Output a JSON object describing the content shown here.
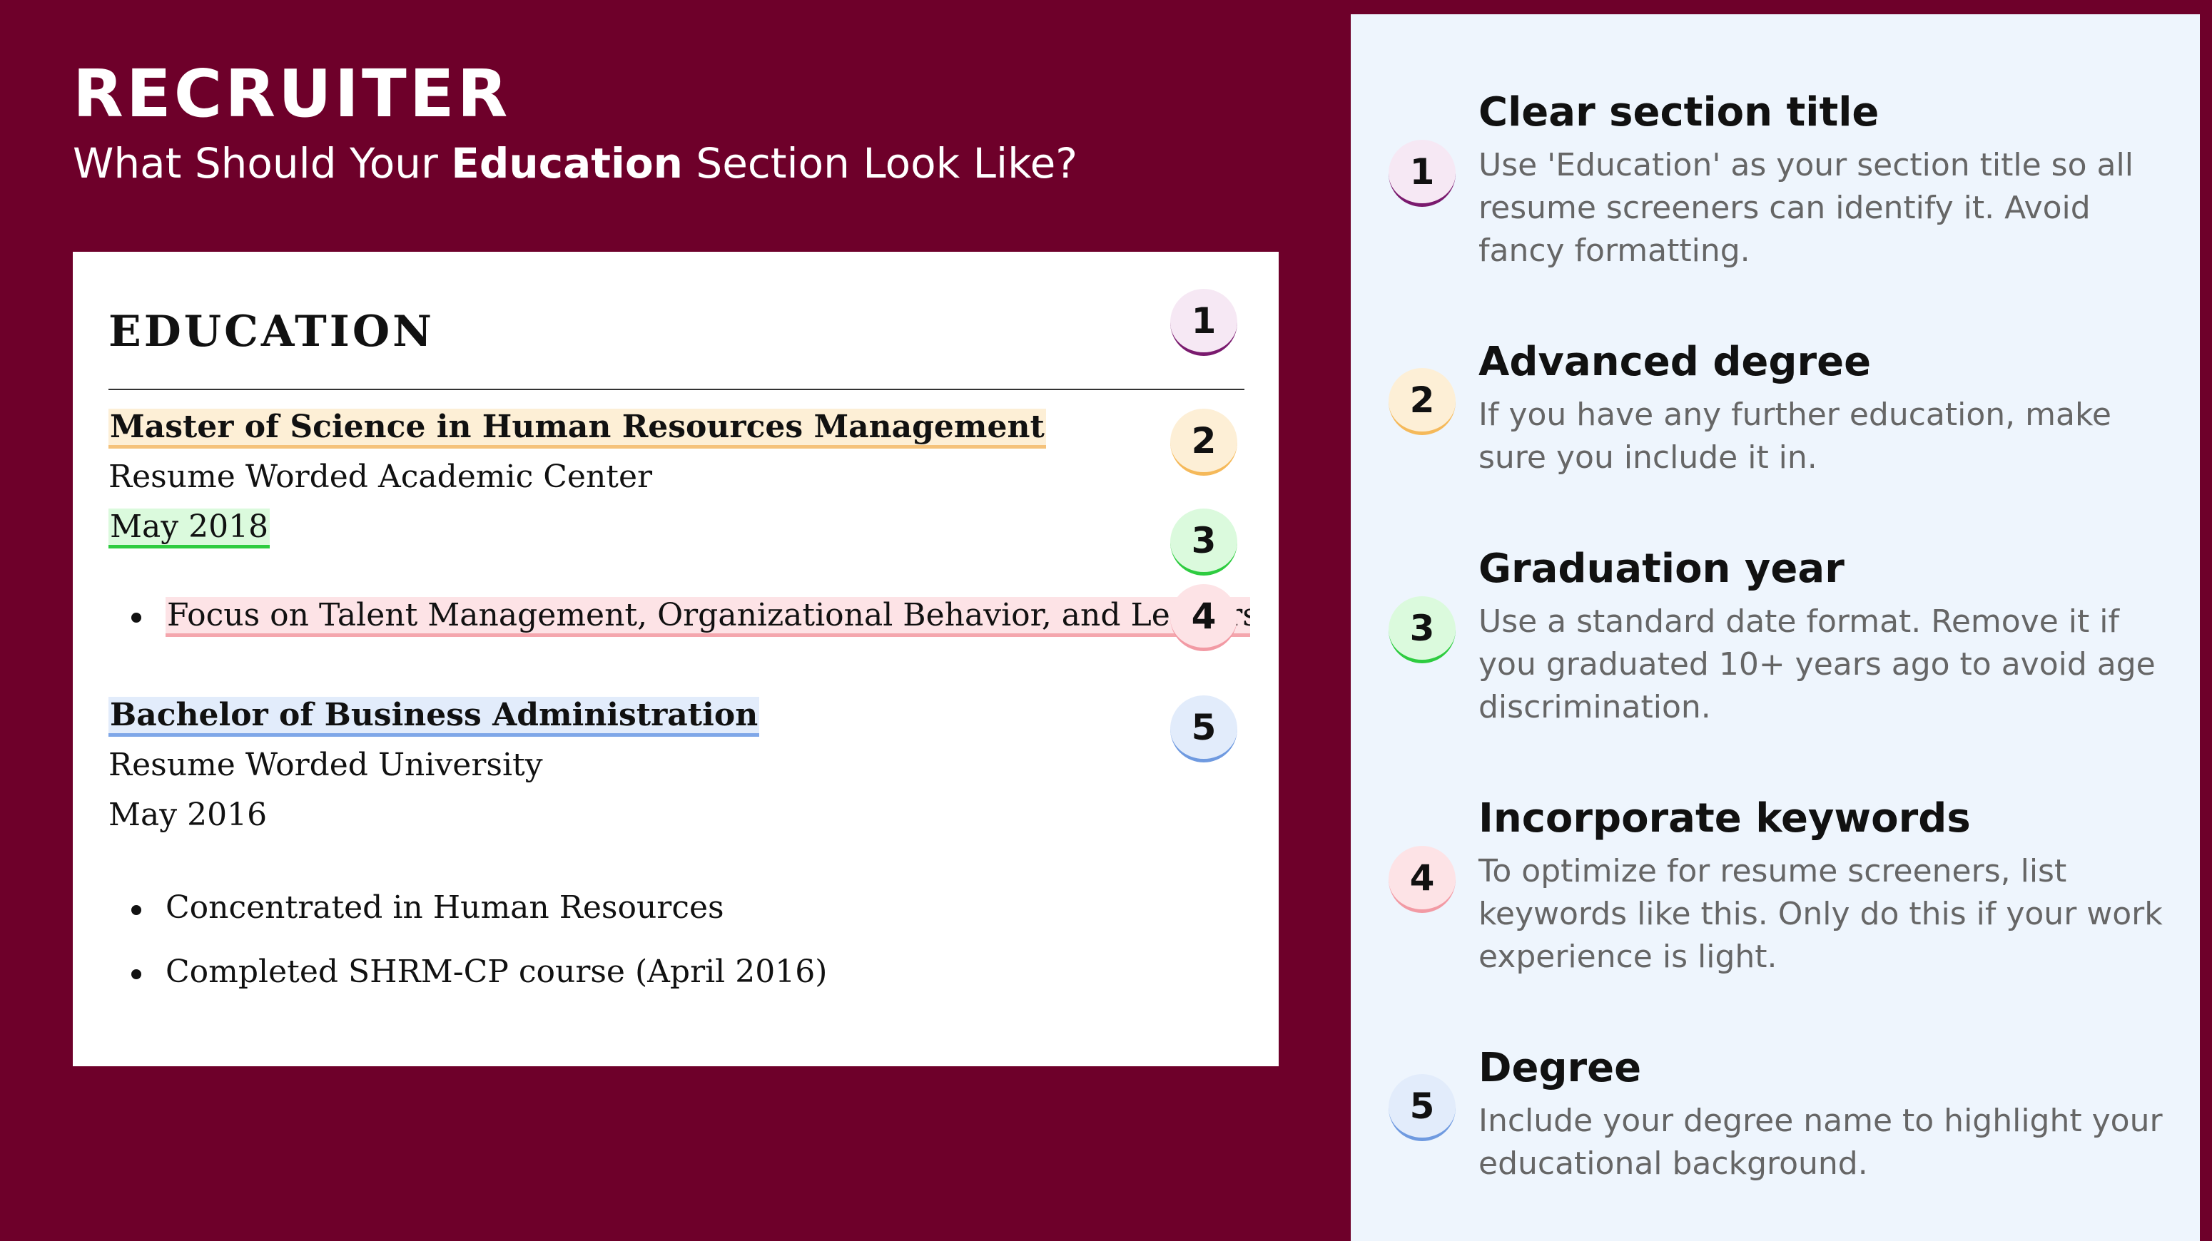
{
  "header": {
    "title": "RECRUITER",
    "subtitle_prefix": "What Should Your ",
    "subtitle_emphasis": "Education",
    "subtitle_suffix": " Section Look Like?"
  },
  "resume": {
    "heading": "EDUCATION",
    "degree1": {
      "name": "Master of Science in Human Resources Management",
      "school": "Resume Worded Academic Center",
      "date": "May 2018",
      "bullets": [
        "Focus on Talent Management, Organizational Behavior, and Leadership"
      ]
    },
    "degree2": {
      "name": "Bachelor of Business Administration",
      "school": "Resume Worded University",
      "date": "May 2016",
      "bullets": [
        "Concentrated in Human Resources",
        "Completed SHRM-CP course (April 2016)"
      ]
    }
  },
  "badges": [
    "1",
    "2",
    "3",
    "4",
    "5"
  ],
  "tips": [
    {
      "number": "1",
      "title": "Clear section title",
      "body": "Use 'Education' as your section title so all resume screeners can identify it. Avoid fancy formatting."
    },
    {
      "number": "2",
      "title": "Advanced degree",
      "body": "If you have any further education, make sure you include it in."
    },
    {
      "number": "3",
      "title": "Graduation year",
      "body": "Use a standard date format. Remove it if you graduated 10+ years ago to avoid age discrimination."
    },
    {
      "number": "4",
      "title": "Incorporate keywords",
      "body": "To optimize for resume screeners, list keywords like this. Only do this if your work experience is light."
    },
    {
      "number": "5",
      "title": "Degree",
      "body": "Include your degree name to highlight your educational background."
    }
  ],
  "colors": {
    "background": "#6e002a",
    "panel": "#eef5fd",
    "badge1": "#7a1a6e",
    "badge2": "#f5b95a",
    "badge3": "#2ecc40",
    "badge4": "#f29aa4",
    "badge5": "#6f9ae0"
  }
}
